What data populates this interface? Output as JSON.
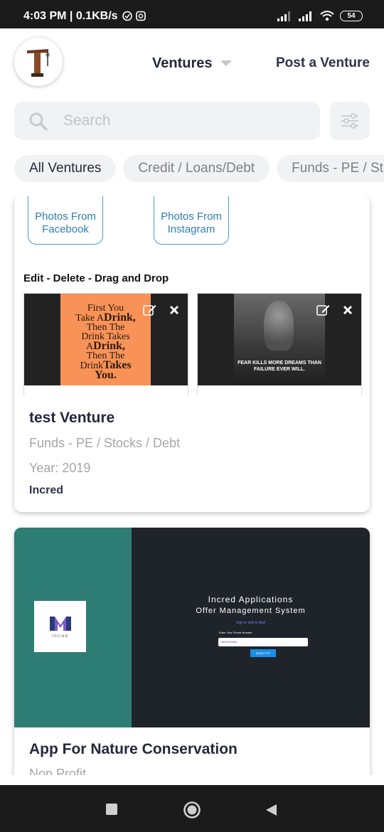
{
  "status_bar": {
    "time_speed": "4:03 PM | 0.1KB/s",
    "battery": "54"
  },
  "header": {
    "ventures_label": "Ventures",
    "post_label": "Post a Venture"
  },
  "search": {
    "placeholder": "Search"
  },
  "categories": [
    "All Ventures",
    "Credit / Loans/Debt",
    "Funds - PE / St"
  ],
  "card1": {
    "photos_facebook": "Photos From Facebook",
    "photos_instagram": "Photos From Instagram",
    "edit_label": "Edit - Delete - Drag and Drop",
    "img1": {
      "l1": "First You",
      "l2": "Take A",
      "l2b": "Drink,",
      "l3": "Then The",
      "l4": "Drink Takes",
      "l5": "A",
      "l5b": "Drink,",
      "l6": "Then The",
      "l7": "Drink",
      "l7b": "Takes",
      "l8": "You."
    },
    "img2": {
      "caption": "FEAR KILLS MORE DREAMS THAN FAILURE EVER WILL."
    },
    "title": "test Venture",
    "category": "Funds - PE / Stocks / Debt",
    "year": "Year: 2019",
    "org": "Incred"
  },
  "card2": {
    "logo_text": "Incred",
    "heading": "Incred Applications",
    "subheading": "Offer Management System",
    "sign_in": "Sign in with E-Mail",
    "phone_label": "Enter Your Phone Number",
    "phone_value": "9891900000",
    "button": "SEND OTP",
    "title": "App For Nature Conservation",
    "category": "Non Profit"
  },
  "colors": {
    "accent": "#23293a",
    "chip_bg": "#f1f2f4",
    "link_blue": "#2f7db0",
    "teal": "#2e7d74",
    "dark": "#1f242b"
  }
}
